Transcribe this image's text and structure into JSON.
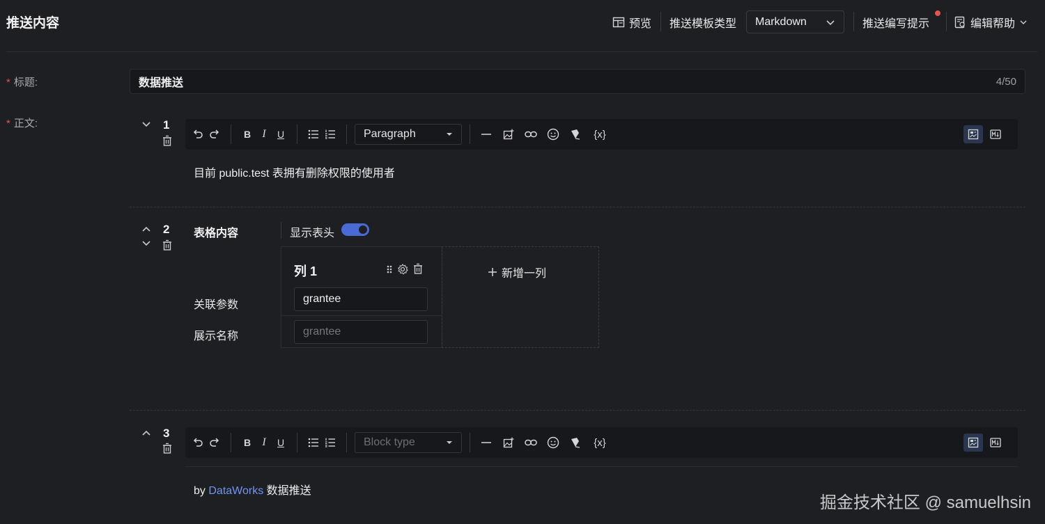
{
  "header": {
    "title": "推送内容",
    "preview_label": "预览",
    "template_type_label": "推送模板类型",
    "template_type_value": "Markdown",
    "writing_tips_label": "推送编写提示",
    "edit_help_label": "编辑帮助"
  },
  "form": {
    "title_label": "标题:",
    "title_value": "数据推送",
    "title_counter": "4/50",
    "body_label": "正文:"
  },
  "blocks": [
    {
      "number": "1",
      "block_type": "Paragraph",
      "content": "目前 public.test 表拥有删除权限的使用者"
    },
    {
      "number": "2",
      "table_title": "表格内容",
      "show_header_label": "显示表头",
      "show_header_on": true,
      "column_title": "列 1",
      "param_label": "关联参数",
      "param_value": "grantee",
      "display_label": "展示名称",
      "display_placeholder": "grantee",
      "add_column_label": "新增一列"
    },
    {
      "number": "3",
      "block_type_placeholder": "Block type",
      "content_prefix": "by",
      "content_link": "DataWorks",
      "content_suffix": "数据推送"
    }
  ],
  "toolbar": {
    "variable_label": "{x}"
  },
  "watermark": "掘金技术社区 @ samuelhsin",
  "colors": {
    "background": "#1e1f23",
    "accent": "#4a6bd6",
    "required": "#e0554d",
    "link": "#6f95f2"
  }
}
